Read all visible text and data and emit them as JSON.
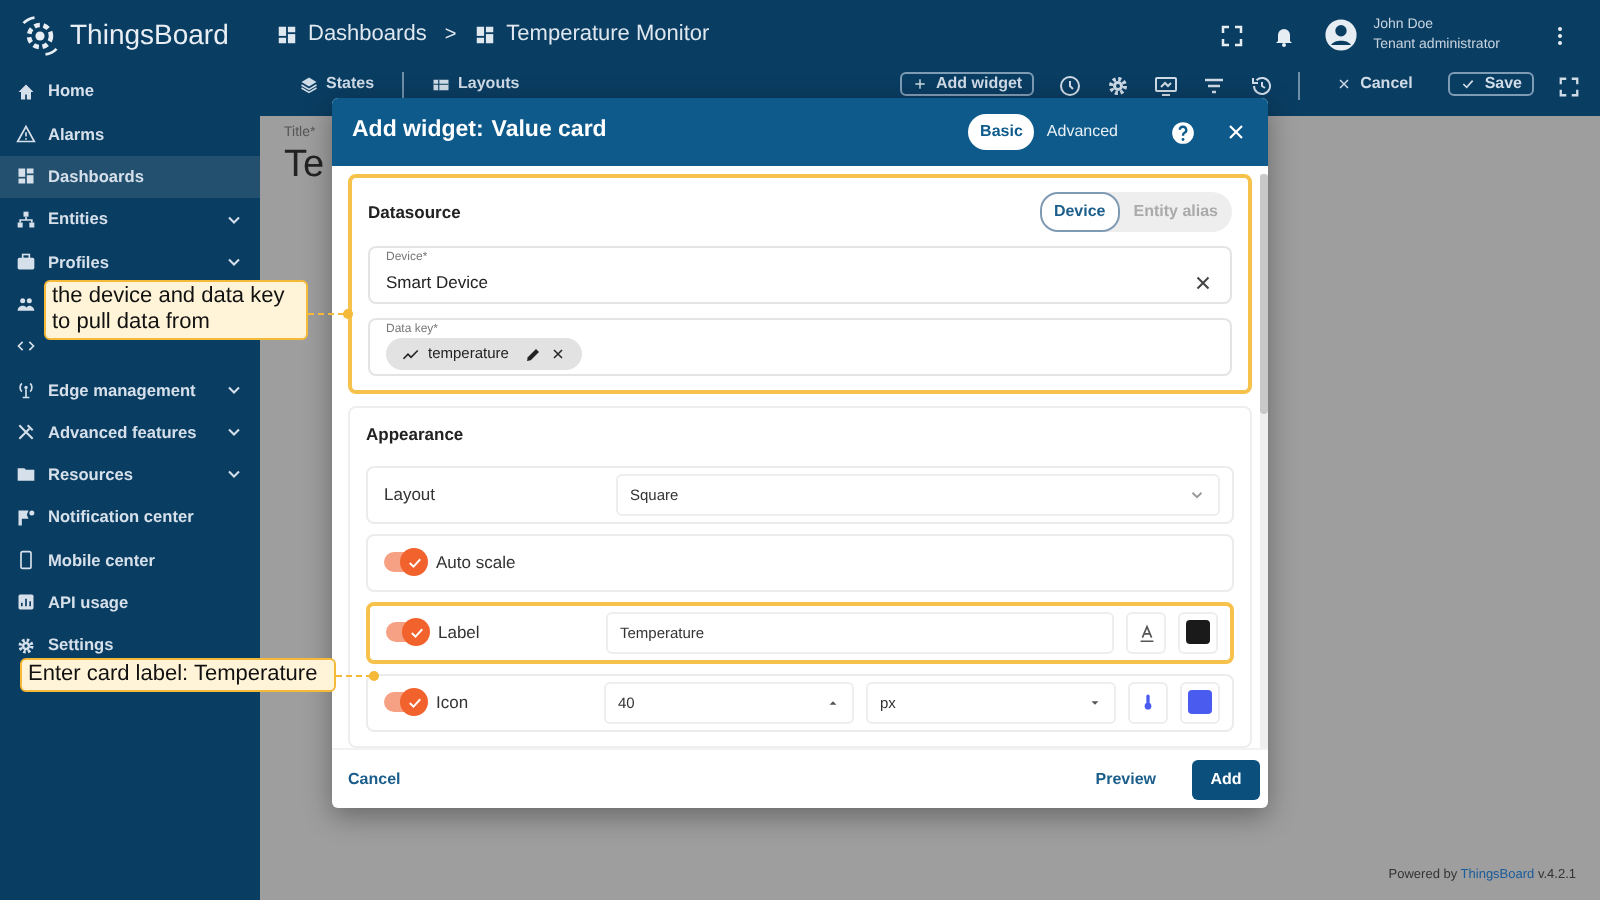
{
  "header": {
    "logo": "ThingsBoard",
    "breadcrumbs": [
      {
        "label": "Dashboards"
      },
      {
        "label": "Temperature Monitor"
      }
    ],
    "separator": ">",
    "user": {
      "name": "John Doe",
      "role": "Tenant administrator"
    }
  },
  "sidebar": {
    "items": [
      {
        "label": "Home",
        "selected": false,
        "expandable": false
      },
      {
        "label": "Alarms",
        "selected": false,
        "expandable": false
      },
      {
        "label": "Dashboards",
        "selected": true,
        "expandable": false
      },
      {
        "label": "Entities",
        "selected": false,
        "expandable": true
      },
      {
        "label": "Profiles",
        "selected": false,
        "expandable": true
      },
      {
        "selected": false,
        "expandable": false
      },
      {
        "selected": false,
        "expandable": false
      },
      {
        "label": "Edge management",
        "selected": false,
        "expandable": true
      },
      {
        "label": "Advanced features",
        "selected": false,
        "expandable": true
      },
      {
        "label": "Resources",
        "selected": false,
        "expandable": true
      },
      {
        "label": "Notification center",
        "selected": false,
        "expandable": false
      },
      {
        "label": "Mobile center",
        "selected": false,
        "expandable": false
      },
      {
        "label": "API usage",
        "selected": false,
        "expandable": false
      },
      {
        "label": "Settings",
        "selected": false,
        "expandable": false
      }
    ]
  },
  "toolbar": {
    "tabs": [
      {
        "label": "States"
      },
      {
        "label": "Layouts"
      }
    ],
    "add_widget": "Add widget",
    "cancel": "Cancel",
    "save": "Save"
  },
  "dashboard": {
    "title_label": "Title*",
    "title": "Te"
  },
  "dialog": {
    "title": "Add widget:",
    "widget_name": "Value card",
    "modes": [
      {
        "label": "Basic",
        "selected": true
      },
      {
        "label": "Advanced",
        "selected": false
      }
    ],
    "datasource": {
      "title": "Datasource",
      "highlighted": true,
      "types": [
        {
          "label": "Device",
          "selected": true
        },
        {
          "label": "Entity alias",
          "selected": false
        }
      ],
      "device": {
        "label": "Device*",
        "value": "Smart Device"
      },
      "data_key": {
        "label": "Data key*",
        "chips": [
          {
            "label": "temperature"
          }
        ]
      }
    },
    "appearance": {
      "title": "Appearance",
      "rows": [
        {
          "kind": "select",
          "label": "Layout",
          "value": "Square",
          "highlighted": false
        },
        {
          "kind": "toggle",
          "label": "Auto scale",
          "on": true,
          "highlighted": false
        },
        {
          "kind": "toggle-text",
          "label": "Label",
          "on": true,
          "value": "Temperature",
          "color": "#1a1a1a",
          "highlighted": true
        },
        {
          "kind": "toggle-size",
          "label": "Icon",
          "on": true,
          "value": "40",
          "unit": "px",
          "color": "#4a5cf0",
          "highlighted": false
        }
      ]
    },
    "buttons": {
      "cancel": "Cancel",
      "preview": "Preview",
      "add": "Add"
    }
  },
  "callouts": [
    {
      "text": "the device and data key to pull data from"
    },
    {
      "text": "Enter card label: Temperature"
    }
  ],
  "footer": {
    "prefix": "Powered by",
    "brand": "ThingsBoard",
    "version": "v.4.2.1"
  }
}
